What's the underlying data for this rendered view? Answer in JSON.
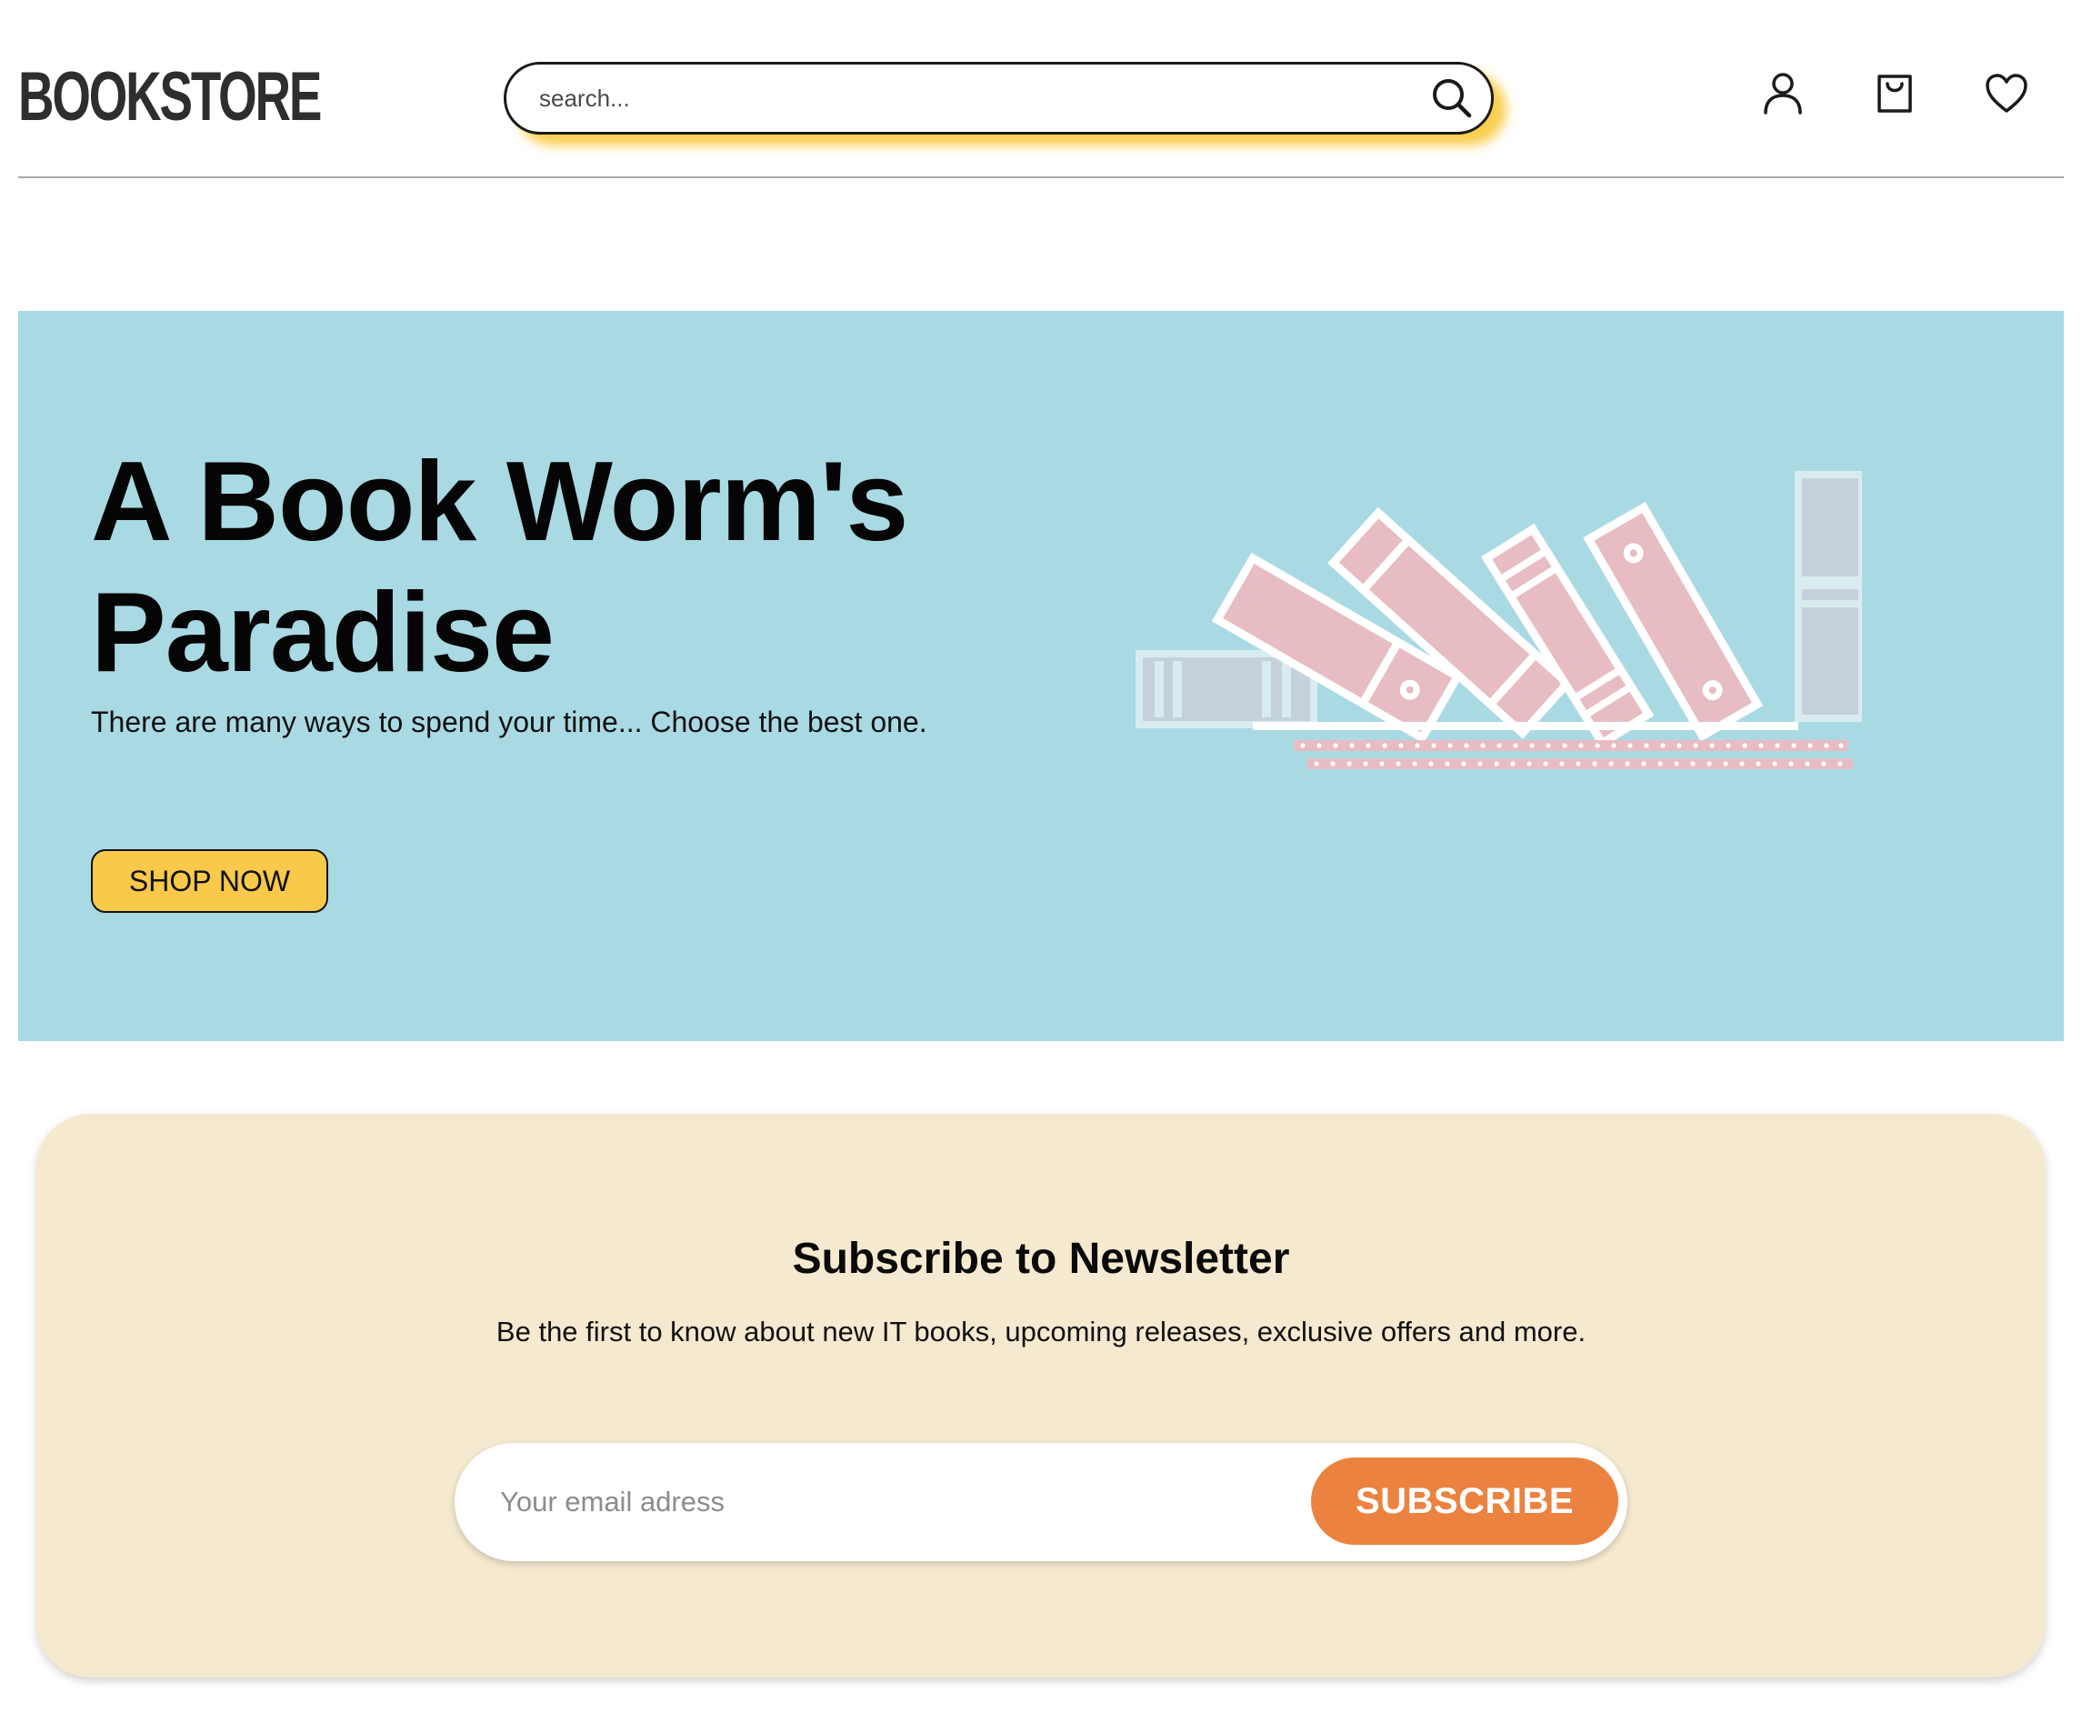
{
  "header": {
    "logo": "BOOKSTORE",
    "search": {
      "placeholder": "search..."
    },
    "icons": [
      "search-icon",
      "user-icon",
      "shopping-bag-icon",
      "heart-icon"
    ]
  },
  "hero": {
    "title": "A Book Worm's Paradise",
    "subtitle": "There are many ways to spend your time... Choose the best one.",
    "button_label": "SHOP NOW",
    "illustration": "books-on-shelf-illustration"
  },
  "newsletter": {
    "title": "Subscribe to Newsletter",
    "subtitle": "Be the first to know about new IT books, upcoming releases, exclusive offers and more.",
    "email_placeholder": "Your email adress",
    "button_label": "SUBSCRIBE"
  },
  "colors": {
    "hero_bg": "#a9dae4",
    "accent_yellow": "#f8c94a",
    "newsletter_bg": "#f5e9cf",
    "subscribe_orange": "#ec8240",
    "book_pink": "#e8bcc3",
    "book_gray": "#c5d1da"
  }
}
